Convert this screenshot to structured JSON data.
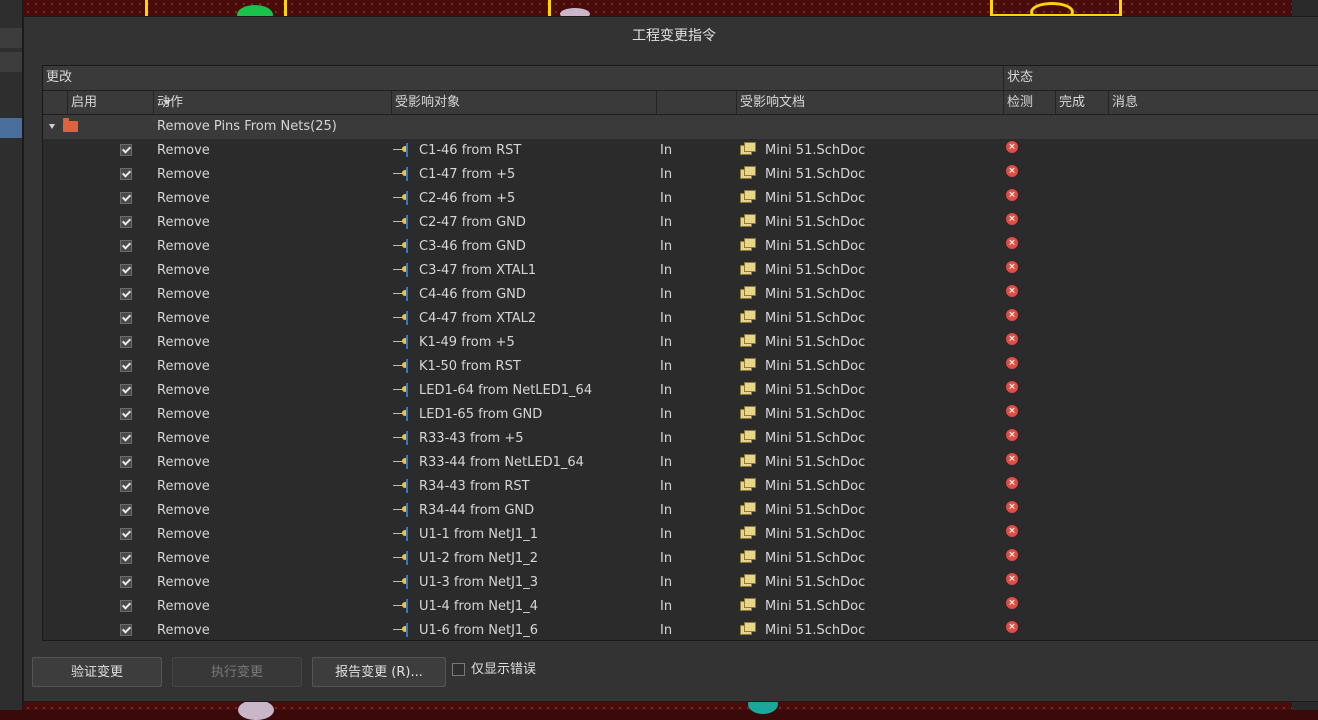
{
  "dialog": {
    "title": "工程变更指令"
  },
  "header": {
    "group_changes": "更改",
    "group_status": "状态",
    "col_enable": "启用",
    "col_action": "动作",
    "col_affected_object": "受影响对象",
    "col_affected_doc": "受影响文档",
    "col_check": "检测",
    "col_done": "完成",
    "col_message": "消息"
  },
  "group_row": {
    "label": "Remove Pins From Nets(25)"
  },
  "rows": [
    {
      "action": "Remove",
      "object": "C1-46 from RST",
      "dir": "In",
      "doc": "Mini 51.SchDoc"
    },
    {
      "action": "Remove",
      "object": "C1-47 from +5",
      "dir": "In",
      "doc": "Mini 51.SchDoc"
    },
    {
      "action": "Remove",
      "object": "C2-46 from +5",
      "dir": "In",
      "doc": "Mini 51.SchDoc"
    },
    {
      "action": "Remove",
      "object": "C2-47 from GND",
      "dir": "In",
      "doc": "Mini 51.SchDoc"
    },
    {
      "action": "Remove",
      "object": "C3-46 from GND",
      "dir": "In",
      "doc": "Mini 51.SchDoc"
    },
    {
      "action": "Remove",
      "object": "C3-47 from XTAL1",
      "dir": "In",
      "doc": "Mini 51.SchDoc"
    },
    {
      "action": "Remove",
      "object": "C4-46 from GND",
      "dir": "In",
      "doc": "Mini 51.SchDoc"
    },
    {
      "action": "Remove",
      "object": "C4-47 from XTAL2",
      "dir": "In",
      "doc": "Mini 51.SchDoc"
    },
    {
      "action": "Remove",
      "object": "K1-49 from +5",
      "dir": "In",
      "doc": "Mini 51.SchDoc"
    },
    {
      "action": "Remove",
      "object": "K1-50 from RST",
      "dir": "In",
      "doc": "Mini 51.SchDoc"
    },
    {
      "action": "Remove",
      "object": "LED1-64 from NetLED1_64",
      "dir": "In",
      "doc": "Mini 51.SchDoc"
    },
    {
      "action": "Remove",
      "object": "LED1-65 from GND",
      "dir": "In",
      "doc": "Mini 51.SchDoc"
    },
    {
      "action": "Remove",
      "object": "R33-43 from +5",
      "dir": "In",
      "doc": "Mini 51.SchDoc"
    },
    {
      "action": "Remove",
      "object": "R33-44 from NetLED1_64",
      "dir": "In",
      "doc": "Mini 51.SchDoc"
    },
    {
      "action": "Remove",
      "object": "R34-43 from RST",
      "dir": "In",
      "doc": "Mini 51.SchDoc"
    },
    {
      "action": "Remove",
      "object": "R34-44 from GND",
      "dir": "In",
      "doc": "Mini 51.SchDoc"
    },
    {
      "action": "Remove",
      "object": "U1-1 from NetJ1_1",
      "dir": "In",
      "doc": "Mini 51.SchDoc"
    },
    {
      "action": "Remove",
      "object": "U1-2 from NetJ1_2",
      "dir": "In",
      "doc": "Mini 51.SchDoc"
    },
    {
      "action": "Remove",
      "object": "U1-3 from NetJ1_3",
      "dir": "In",
      "doc": "Mini 51.SchDoc"
    },
    {
      "action": "Remove",
      "object": "U1-4 from NetJ1_4",
      "dir": "In",
      "doc": "Mini 51.SchDoc"
    },
    {
      "action": "Remove",
      "object": "U1-6 from NetJ1_6",
      "dir": "In",
      "doc": "Mini 51.SchDoc"
    }
  ],
  "buttons": {
    "validate": "验证变更",
    "execute": "执行变更",
    "report": "报告变更 (R)...",
    "only_errors": "仅显示错误"
  },
  "colors": {
    "error": "#e24b3f",
    "folder": "#e0613d",
    "pcb_outline": "#ffd400"
  }
}
